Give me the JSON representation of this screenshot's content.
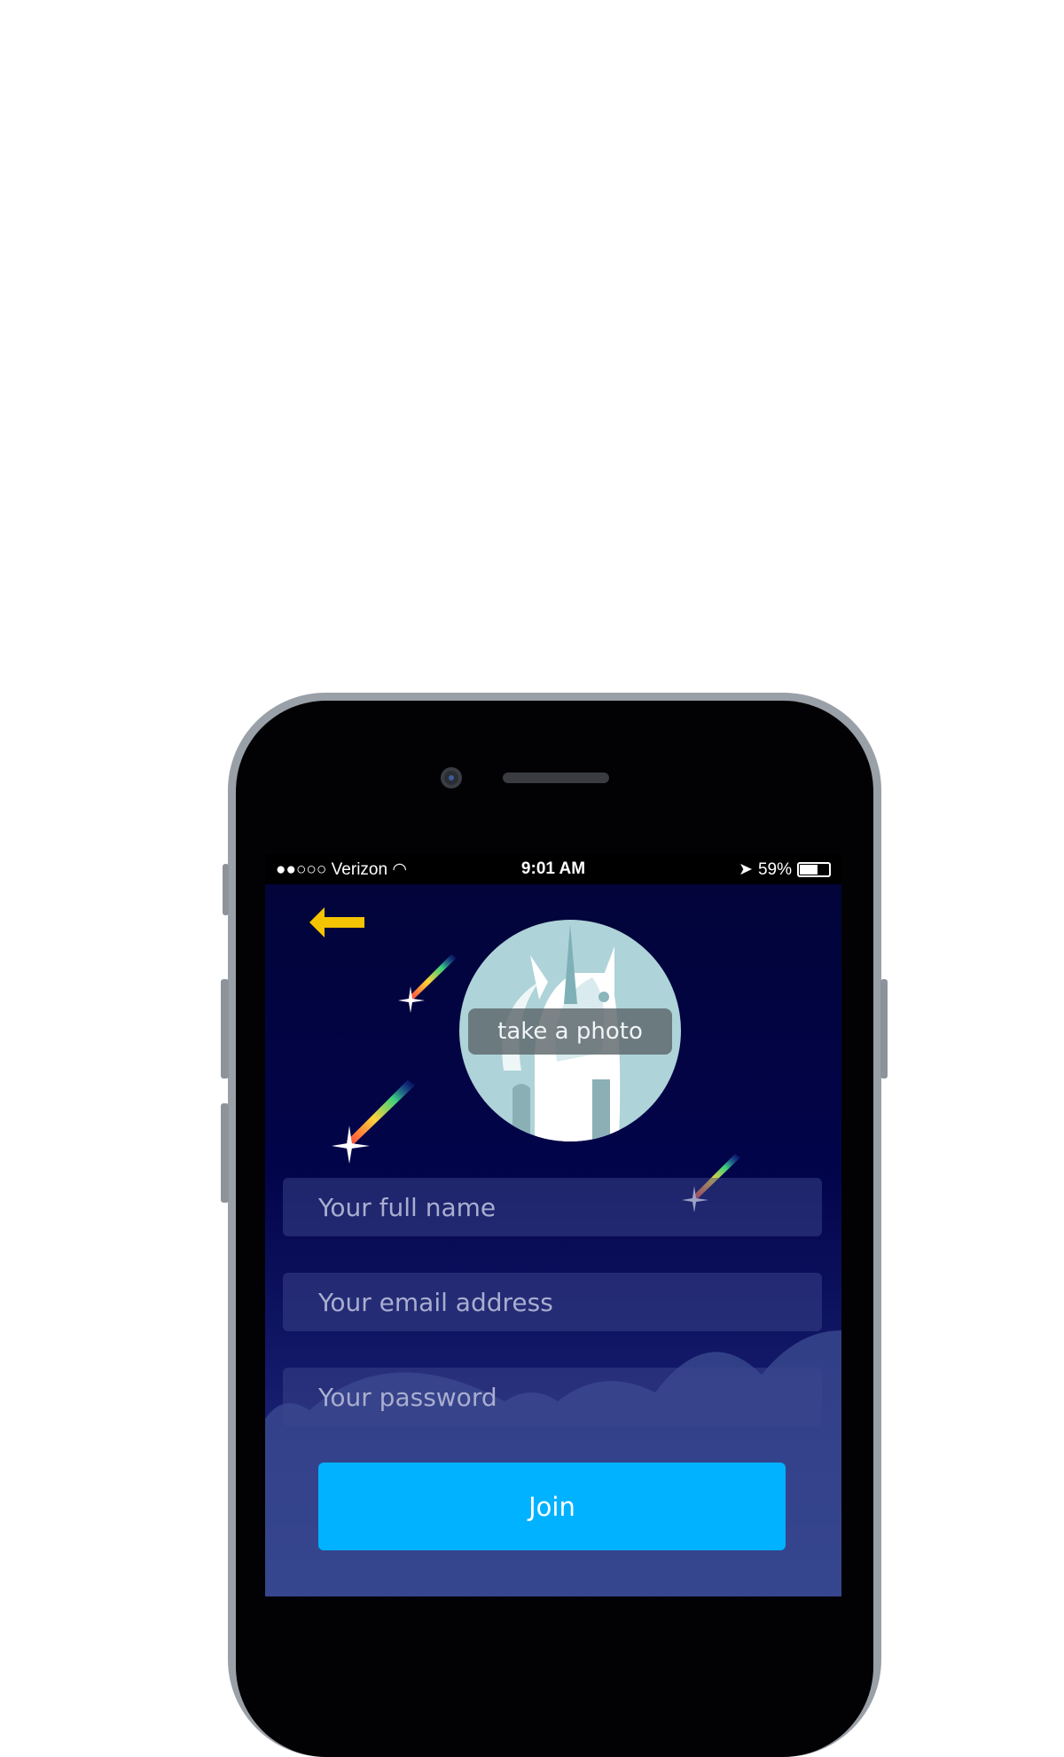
{
  "status_bar": {
    "signal": "●●○○○",
    "carrier": "Verizon",
    "time": "9:01 AM",
    "battery": "59%",
    "battery_level": 0.59
  },
  "back_icon": "arrow-left-icon",
  "colors": {
    "accent": "#00b2ff",
    "back_arrow": "#f5c400",
    "background": "#02044a"
  },
  "avatar": {
    "overlay_label": "take a photo"
  },
  "form": {
    "name_placeholder": "Your full name",
    "email_placeholder": "Your email address",
    "password_placeholder": "Your password",
    "join_label": "Join"
  }
}
